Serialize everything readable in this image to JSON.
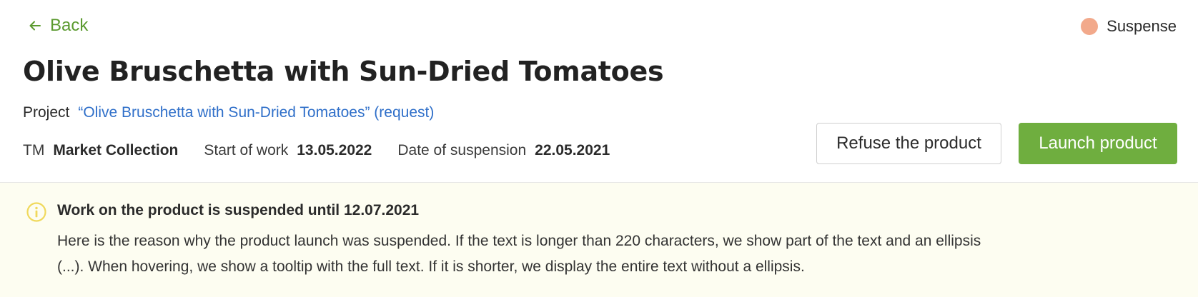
{
  "nav": {
    "back_label": "Back"
  },
  "status": {
    "label": "Suspense",
    "dot_color": "#f2a98b"
  },
  "product": {
    "title": "Olive Bruschetta with Sun-Dried Tomatoes"
  },
  "project": {
    "label": "Project",
    "link_text": "“Olive Bruschetta with Sun-Dried Tomatoes” (request)"
  },
  "meta": {
    "tm_label": "TM",
    "tm_value": "Market Collection",
    "start_label": "Start of work",
    "start_value": "13.05.2022",
    "suspension_label": "Date of suspension",
    "suspension_value": "22.05.2021"
  },
  "actions": {
    "refuse_label": "Refuse the product",
    "launch_label": "Launch product",
    "launch_color": "#6fae3f"
  },
  "notice": {
    "icon": "info-icon",
    "icon_color": "#f0d95c",
    "title": "Work on the product is suspended until 12.07.2021",
    "text": "Here is the reason why the product launch was suspended. If the text is longer than 220 characters, we show part of the text and an ellipsis (...). When hovering, we show a tooltip with the full text. If it is shorter, we display the entire text without a ellipsis."
  }
}
